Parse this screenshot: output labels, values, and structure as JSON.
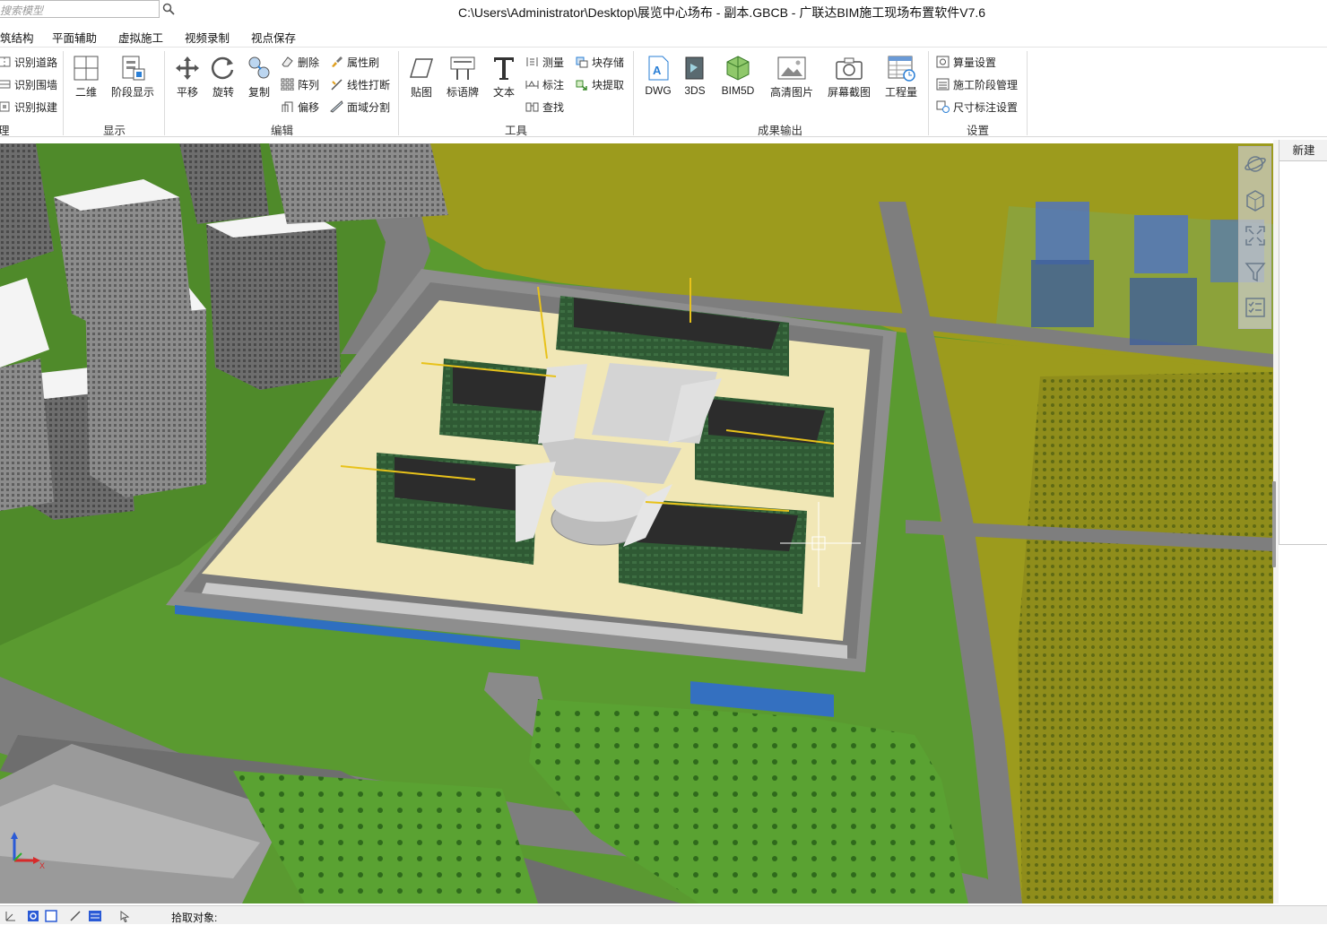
{
  "search": {
    "placeholder": "搜索模型"
  },
  "window": {
    "title": "C:\\Users\\Administrator\\Desktop\\展览中心场布 - 副本.GBCB - 广联达BIM施工现场布置软件V7.6"
  },
  "menu": {
    "items": [
      {
        "label": "筑结构"
      },
      {
        "label": "平面辅助"
      },
      {
        "label": "虚拟施工"
      },
      {
        "label": "视频录制"
      },
      {
        "label": "视点保存"
      }
    ]
  },
  "ribbon": {
    "recognize": {
      "items": [
        {
          "label": "识别道路",
          "icon": "road-recognize-icon"
        },
        {
          "label": "识别围墙",
          "icon": "wall-recognize-icon"
        },
        {
          "label": "识别拟建",
          "icon": "building-recognize-icon"
        }
      ],
      "group_label": "理"
    },
    "display": {
      "buttons": [
        {
          "label": "二维",
          "icon": "2d-view-icon"
        },
        {
          "label": "阶段显示",
          "icon": "stage-display-icon"
        }
      ],
      "group_label": "显示"
    },
    "edit": {
      "buttons": [
        {
          "label": "平移",
          "icon": "move-icon"
        },
        {
          "label": "旋转",
          "icon": "rotate-icon"
        },
        {
          "label": "复制",
          "icon": "copy-icon"
        }
      ],
      "small_col1": [
        {
          "label": "删除",
          "icon": "eraser-icon"
        },
        {
          "label": "阵列",
          "icon": "array-icon"
        },
        {
          "label": "偏移",
          "icon": "offset-icon"
        }
      ],
      "small_col2": [
        {
          "label": "属性刷",
          "icon": "brush-icon"
        },
        {
          "label": "线性打断",
          "icon": "break-line-icon"
        },
        {
          "label": "面域分割",
          "icon": "split-region-icon"
        }
      ],
      "group_label": "编辑"
    },
    "tools": {
      "buttons": [
        {
          "label": "贴图",
          "icon": "texture-icon"
        },
        {
          "label": "标语牌",
          "icon": "signboard-icon"
        },
        {
          "label": "文本",
          "icon": "text-icon"
        }
      ],
      "small_col1": [
        {
          "label": "测量",
          "icon": "measure-icon"
        },
        {
          "label": "标注",
          "icon": "dimension-icon"
        },
        {
          "label": "查找",
          "icon": "find-icon"
        }
      ],
      "small_col2": [
        {
          "label": "块存储",
          "icon": "block-save-icon"
        },
        {
          "label": "块提取",
          "icon": "block-extract-icon"
        }
      ],
      "group_label": "工具"
    },
    "output": {
      "buttons": [
        {
          "label": "DWG",
          "icon": "dwg-icon"
        },
        {
          "label": "3DS",
          "icon": "3ds-icon"
        },
        {
          "label": "BIM5D",
          "icon": "bim5d-icon"
        },
        {
          "label": "高清图片",
          "icon": "hd-image-icon"
        },
        {
          "label": "屏幕截图",
          "icon": "camera-icon"
        },
        {
          "label": "工程量",
          "icon": "quantity-icon"
        }
      ],
      "group_label": "成果输出"
    },
    "settings": {
      "items": [
        {
          "label": "算量设置",
          "icon": "calc-settings-icon"
        },
        {
          "label": "施工阶段管理",
          "icon": "stage-manage-icon"
        },
        {
          "label": "尺寸标注设置",
          "icon": "dimension-settings-icon"
        }
      ],
      "group_label": "设置"
    }
  },
  "right_panel": {
    "tab_label": "新建"
  },
  "axis": {
    "x_label": "X"
  },
  "status": {
    "pick_label": "拾取对象:"
  },
  "colors": {
    "grass": "#4f8a2a",
    "field": "#9c9b1d",
    "road": "#8a8a8a",
    "site": "#f1e7b6",
    "building_roof": "#3a6a3a",
    "selection": "#2a7fd6"
  }
}
